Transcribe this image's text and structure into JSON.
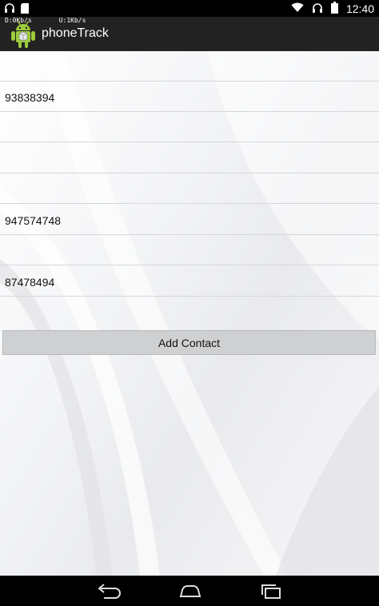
{
  "status_bar": {
    "time": "12:40",
    "download_rate": "D:0Kb/s",
    "upload_rate": "U:1Kb/s",
    "icons": [
      "headphones-icon",
      "sd-card-icon",
      "wifi-icon",
      "headphones-icon",
      "battery-icon"
    ]
  },
  "action_bar": {
    "title": "phoneTrack",
    "icon": "android-robot-icon"
  },
  "contacts": {
    "rows": [
      {
        "value": ""
      },
      {
        "value": "93838394"
      },
      {
        "value": ""
      },
      {
        "value": ""
      },
      {
        "value": ""
      },
      {
        "value": "947574748"
      },
      {
        "value": ""
      },
      {
        "value": "87478494"
      }
    ]
  },
  "add_button": {
    "label": "Add Contact"
  },
  "nav_bar": {
    "icons": [
      "back-icon",
      "home-icon",
      "recent-apps-icon"
    ]
  }
}
